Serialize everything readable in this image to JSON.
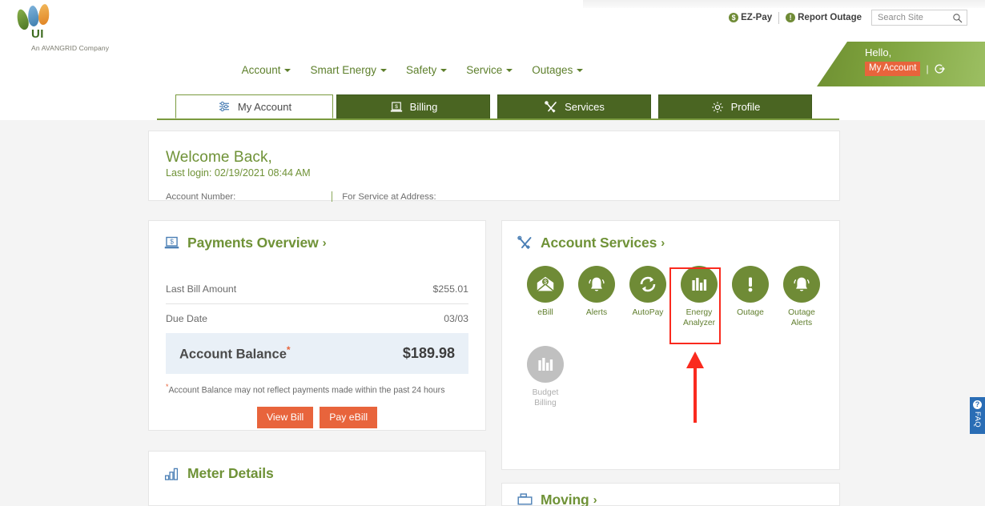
{
  "brand": {
    "logo_text": "UI",
    "tagline": "An AVANGRID Company",
    "logo_icon": "three-leaves-logo"
  },
  "utility_bar": {
    "ez_pay": "EZ-Pay",
    "ez_pay_icon": "dollar-circle-icon",
    "report_outage": "Report Outage",
    "report_outage_icon": "exclamation-circle-icon",
    "search_placeholder": "Search Site",
    "search_value": "",
    "search_icon": "magnifier-icon"
  },
  "user_banner": {
    "greeting": "Hello,",
    "my_account": "My Account",
    "logout_icon": "logout-icon",
    "accent_color": "#e8643c"
  },
  "main_nav": {
    "items": [
      {
        "label": "Account"
      },
      {
        "label": "Smart Energy"
      },
      {
        "label": "Safety"
      },
      {
        "label": "Service"
      },
      {
        "label": "Outages"
      }
    ]
  },
  "tabs": [
    {
      "label": "My Account",
      "icon": "sliders-icon",
      "active": true
    },
    {
      "label": "Billing",
      "icon": "laptop-bill-icon",
      "active": false
    },
    {
      "label": "Services",
      "icon": "tools-icon",
      "active": false
    },
    {
      "label": "Profile",
      "icon": "gear-icon",
      "active": false
    }
  ],
  "welcome": {
    "title": "Welcome Back,",
    "last_login": "Last login: 02/19/2021 08:44 AM",
    "account_number_label": "Account Number:",
    "account_number_value": "",
    "service_address_label": "For Service at Address:",
    "service_address_value": ""
  },
  "payments_overview": {
    "title": "Payments Overview",
    "title_icon": "laptop-bill-icon",
    "arrow": "›",
    "rows": [
      {
        "label": "Last Bill Amount",
        "value": "$255.01"
      },
      {
        "label": "Due Date",
        "value": "03/03"
      }
    ],
    "balance_label": "Account Balance",
    "balance_asterisk": "*",
    "balance_value": "$189.98",
    "footnote_asterisk": "*",
    "footnote": "Account Balance may not reflect payments made within the past 24 hours",
    "buttons": [
      {
        "label": "View Bill"
      },
      {
        "label": "Pay eBill"
      }
    ]
  },
  "account_services": {
    "title": "Account Services",
    "title_icon": "tools-icon",
    "arrow": "›",
    "items": [
      {
        "label": "eBill",
        "icon": "envelope-dollar-icon",
        "disabled": false,
        "highlighted": false
      },
      {
        "label": "Alerts",
        "icon": "bell-icon",
        "disabled": false,
        "highlighted": false
      },
      {
        "label": "AutoPay",
        "icon": "refresh-cycle-icon",
        "disabled": false,
        "highlighted": false
      },
      {
        "label": "Energy\nAnalyzer",
        "icon": "bar-chart-icon",
        "disabled": false,
        "highlighted": true
      },
      {
        "label": "Outage",
        "icon": "exclamation-icon",
        "disabled": false,
        "highlighted": false
      },
      {
        "label": "Outage\nAlerts",
        "icon": "bell-icon",
        "disabled": false,
        "highlighted": false
      },
      {
        "label": "Budget\nBilling",
        "icon": "bar-chart-icon",
        "disabled": true,
        "highlighted": false
      }
    ]
  },
  "annotation": {
    "highlight_color": "#fa2a1e",
    "highlight_target": "Energy Analyzer",
    "arrow_icon": "up-arrow-annotation"
  },
  "meter_details": {
    "title": "Meter Details",
    "title_icon": "bar-chart-icon"
  },
  "moving": {
    "title": "Moving",
    "title_icon": "box-icon",
    "arrow": "›"
  },
  "faq_tab": {
    "label": "FAQ",
    "icon": "question-circle-icon",
    "color": "#2a6db5"
  }
}
